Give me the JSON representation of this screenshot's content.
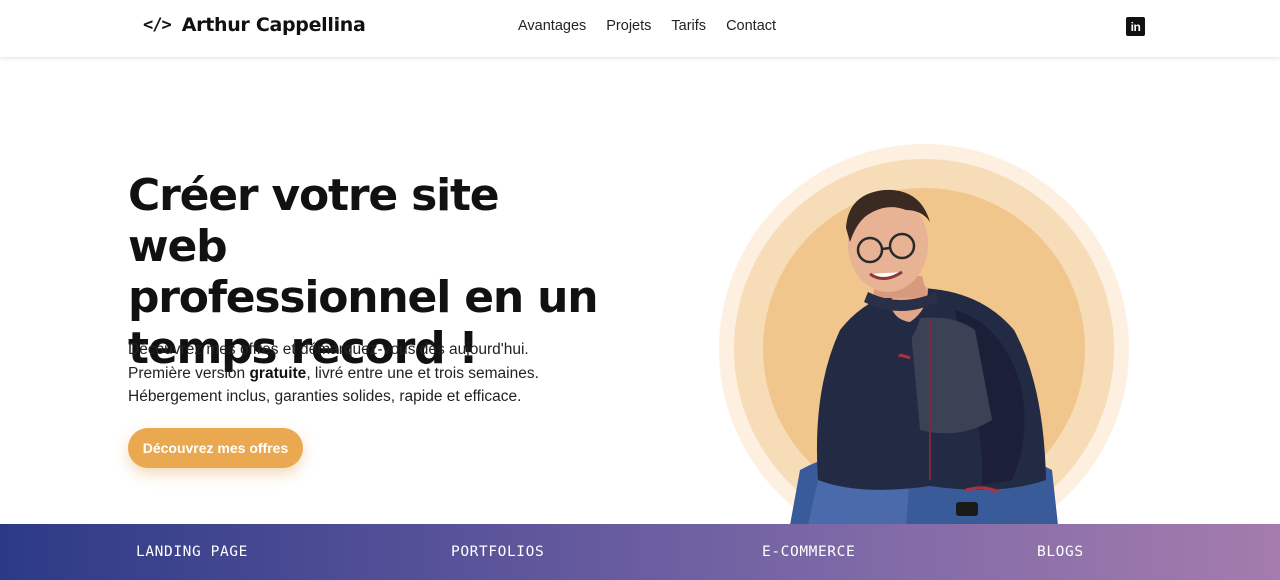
{
  "header": {
    "brand_icon": "</>",
    "brand_name": "Arthur Cappellina",
    "nav": [
      "Avantages",
      "Projets",
      "Tarifs",
      "Contact"
    ],
    "social_icon": "linkedin-icon",
    "social_label": "in"
  },
  "hero": {
    "title_lines": [
      "Créer votre site web",
      "professionnel en un",
      "temps record !"
    ],
    "desc_line1": "Découvrez mes offres et démarquez-vous dès aujourd'hui.",
    "desc_line2_before": "Première version ",
    "desc_line2_bold": "gratuite",
    "desc_line2_after": ", livré entre une et trois semaines.",
    "desc_line3": "Hébergement inclus, garanties solides, rapide et efficace.",
    "cta_label": "Découvrez mes offres"
  },
  "categories": [
    "LANDING PAGE",
    "PORTFOLIOS",
    "E-COMMERCE",
    "BLOGS"
  ],
  "colors": {
    "accent": "#eaa851",
    "band_start": "#2c3a86",
    "band_end": "#a47cad"
  }
}
